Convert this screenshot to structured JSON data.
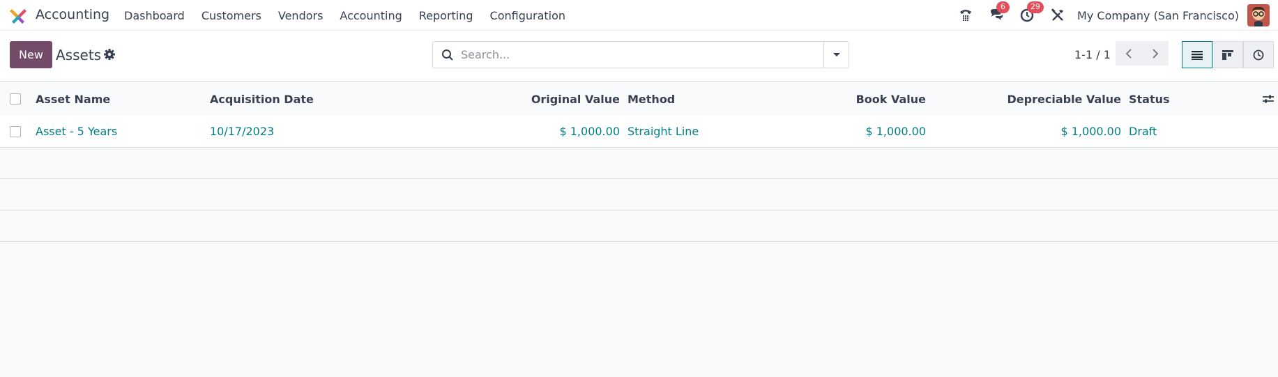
{
  "navbar": {
    "app_name": "Accounting",
    "menu": [
      "Dashboard",
      "Customers",
      "Vendors",
      "Accounting",
      "Reporting",
      "Configuration"
    ],
    "messages_badge": "6",
    "activities_badge": "29",
    "company": "My Company (San Francisco)"
  },
  "control": {
    "new_label": "New",
    "title": "Assets",
    "search_placeholder": "Search...",
    "pager": "1-1 / 1"
  },
  "table": {
    "columns": {
      "name": "Asset Name",
      "date": "Acquisition Date",
      "original": "Original Value",
      "method": "Method",
      "book": "Book Value",
      "depreciable": "Depreciable Value",
      "status": "Status"
    },
    "rows": [
      {
        "name": "Asset - 5 Years",
        "date": "10/17/2023",
        "original": "$ 1,000.00",
        "method": "Straight Line",
        "book": "$ 1,000.00",
        "depreciable": "$ 1,000.00",
        "status": "Draft"
      }
    ]
  },
  "colors": {
    "brand": "#714b67",
    "link": "#017e84",
    "badge": "#e44d5a"
  },
  "icons": [
    "app-logo-icon",
    "phone-icon",
    "chat-icon",
    "clock-icon",
    "tools-icon",
    "gear-icon",
    "search-icon",
    "caret-down-icon",
    "chevron-left-icon",
    "chevron-right-icon",
    "list-view-icon",
    "kanban-view-icon",
    "activity-view-icon",
    "optional-columns-icon"
  ]
}
